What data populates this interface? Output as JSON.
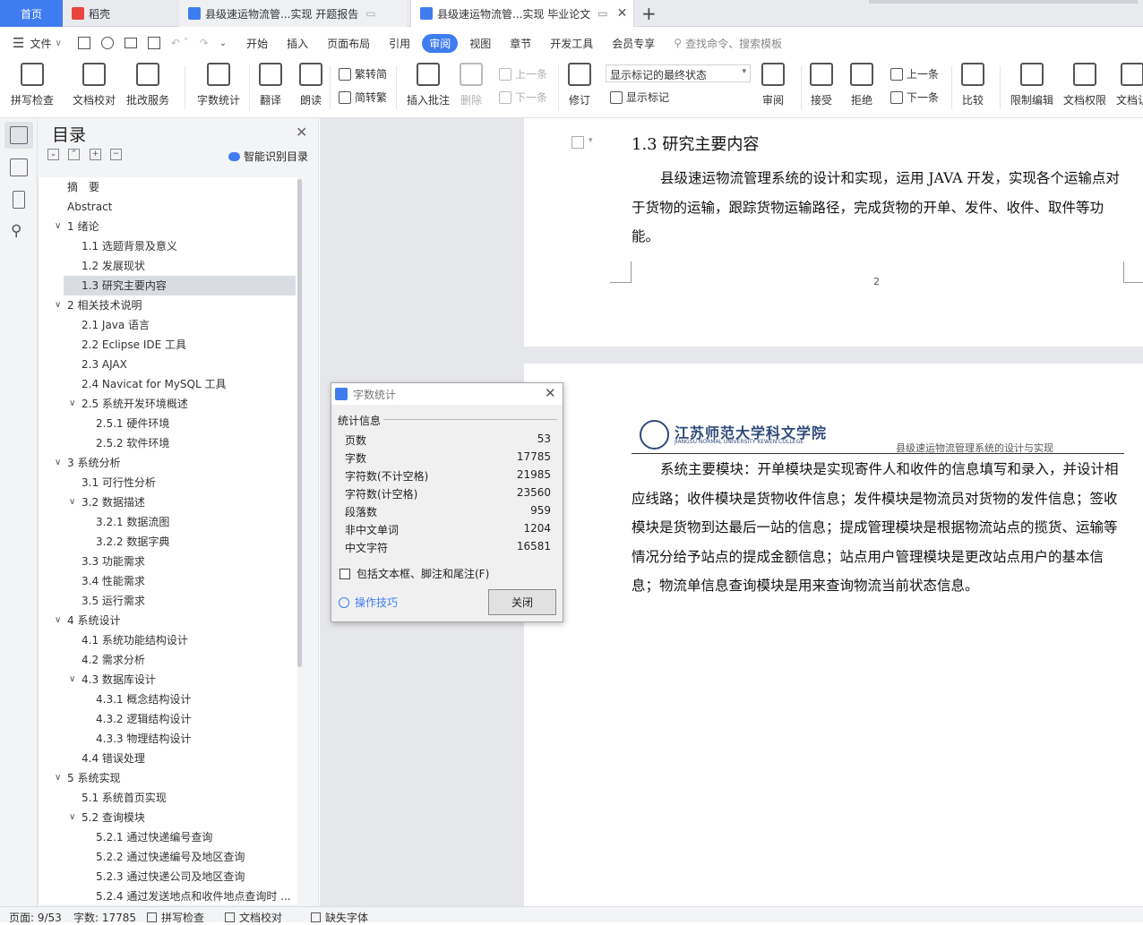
{
  "tabs": [
    {
      "label": "首页"
    },
    {
      "label": "稻壳"
    },
    {
      "label": "县级速运物流管...实现 开题报告"
    },
    {
      "label": "县级速运物流管...实现 毕业论文"
    }
  ],
  "menu": {
    "file": "文件",
    "items": [
      "开始",
      "插入",
      "页面布局",
      "引用",
      "审阅",
      "视图",
      "章节",
      "开发工具",
      "会员专享"
    ],
    "active": "审阅",
    "search_placeholder": "查找命令、搜索模板"
  },
  "ribbon": {
    "spellcheck": "拼写检查",
    "doccheck": "文档校对",
    "correction": "批改服务",
    "wordcount": "字数统计",
    "translate": "翻译",
    "readaloud": "朗读",
    "trad": "繁转简",
    "simp": "简转繁",
    "insert_comment": "插入批注",
    "delete": "删除",
    "prev_comment": "上一条",
    "next_comment": "下一条",
    "revise": "修订",
    "markup_mode": "显示标记的最终状态",
    "show_markup": "显示标记",
    "review": "审阅",
    "accept": "接受",
    "reject": "拒绝",
    "prev": "上一条",
    "next": "下一条",
    "compare": "比较",
    "restrict": "限制编辑",
    "permission": "文档权限",
    "doccheck2": "文档认"
  },
  "toc": {
    "title": "目录",
    "smart_label": "智能识别目录",
    "items": [
      {
        "label": "摘　要",
        "level": 1,
        "toggle": ""
      },
      {
        "label": "Abstract",
        "level": 1,
        "toggle": ""
      },
      {
        "label": "1 绪论",
        "level": 1,
        "toggle": "∨"
      },
      {
        "label": "1.1 选题背景及意义",
        "level": 2,
        "toggle": ""
      },
      {
        "label": "1.2 发展现状",
        "level": 2,
        "toggle": ""
      },
      {
        "label": "1.3 研究主要内容",
        "level": 2,
        "toggle": "",
        "selected": true
      },
      {
        "label": "2 相关技术说明",
        "level": 1,
        "toggle": "∨"
      },
      {
        "label": "2.1 Java 语言",
        "level": 2,
        "toggle": ""
      },
      {
        "label": "2.2 Eclipse IDE 工具",
        "level": 2,
        "toggle": ""
      },
      {
        "label": "2.3 AJAX",
        "level": 2,
        "toggle": ""
      },
      {
        "label": "2.4 Navicat for MySQL 工具",
        "level": 2,
        "toggle": ""
      },
      {
        "label": "2.5 系统开发环境概述",
        "level": 2,
        "toggle": "∨"
      },
      {
        "label": "2.5.1 硬件环境",
        "level": 3,
        "toggle": ""
      },
      {
        "label": "2.5.2 软件环境",
        "level": 3,
        "toggle": ""
      },
      {
        "label": "3 系统分析",
        "level": 1,
        "toggle": "∨"
      },
      {
        "label": "3.1 可行性分析",
        "level": 2,
        "toggle": ""
      },
      {
        "label": "3.2 数据描述",
        "level": 2,
        "toggle": "∨"
      },
      {
        "label": "3.2.1 数据流图",
        "level": 3,
        "toggle": ""
      },
      {
        "label": "3.2.2 数据字典",
        "level": 3,
        "toggle": ""
      },
      {
        "label": "3.3 功能需求",
        "level": 2,
        "toggle": ""
      },
      {
        "label": "3.4 性能需求",
        "level": 2,
        "toggle": ""
      },
      {
        "label": "3.5 运行需求",
        "level": 2,
        "toggle": ""
      },
      {
        "label": "4 系统设计",
        "level": 1,
        "toggle": "∨"
      },
      {
        "label": "4.1 系统功能结构设计",
        "level": 2,
        "toggle": ""
      },
      {
        "label": "4.2 需求分析",
        "level": 2,
        "toggle": ""
      },
      {
        "label": "4.3 数据库设计",
        "level": 2,
        "toggle": "∨"
      },
      {
        "label": "4.3.1 概念结构设计",
        "level": 3,
        "toggle": ""
      },
      {
        "label": "4.3.2 逻辑结构设计",
        "level": 3,
        "toggle": ""
      },
      {
        "label": "4.3.3 物理结构设计",
        "level": 3,
        "toggle": ""
      },
      {
        "label": "4.4 错误处理",
        "level": 2,
        "toggle": ""
      },
      {
        "label": "5 系统实现",
        "level": 1,
        "toggle": "∨"
      },
      {
        "label": "5.1 系统首页实现",
        "level": 2,
        "toggle": ""
      },
      {
        "label": "5.2 查询模块",
        "level": 2,
        "toggle": "∨"
      },
      {
        "label": "5.2.1 通过快递编号查询",
        "level": 3,
        "toggle": ""
      },
      {
        "label": "5.2.2 通过快递编号及地区查询",
        "level": 3,
        "toggle": ""
      },
      {
        "label": "5.2.3 通过快递公司及地区查询",
        "level": 3,
        "toggle": ""
      },
      {
        "label": "5.2.4 通过发送地点和收件地点查询时 ...",
        "level": 3,
        "toggle": ""
      }
    ]
  },
  "document": {
    "heading": "1.3 研究主要内容",
    "para1": "县级速运物流管理系统的设计和实现，运用 JAVA 开发，实现各个运输点对于货物的运输，跟踪货物运输路径，完成货物的开单、发件、收件、取件等功能。",
    "page_number": "2",
    "college_name": "江苏师范大学科文学院",
    "college_en": "JIANGSU NORMAL UNIVERSITY KEWEN COLLEGE",
    "running_header": "县级速运物流管理系统的设计与实现",
    "para2": "系统主要模块：开单模块是实现寄件人和收件的信息填写和录入，并设计相应线路；收件模块是货物收件信息；发件模块是物流员对货物的发件信息；签收模块是货物到达最后一站的信息；提成管理模块是根据物流站点的揽货、运输等情况分给予站点的提成金额信息；站点用户管理模块是更改站点用户的基本信息；物流单信息查询模块是用来查询物流当前状态信息。"
  },
  "dialog": {
    "title": "字数统计",
    "section": "统计信息",
    "stats": [
      {
        "label": "页数",
        "value": "53"
      },
      {
        "label": "字数",
        "value": "17785"
      },
      {
        "label": "字符数(不计空格)",
        "value": "21985"
      },
      {
        "label": "字符数(计空格)",
        "value": "23560"
      },
      {
        "label": "段落数",
        "value": "959"
      },
      {
        "label": "非中文单词",
        "value": "1204"
      },
      {
        "label": "中文字符",
        "value": "16581"
      }
    ],
    "include_label": "包括文本框、脚注和尾注(F)",
    "tips": "操作技巧",
    "close": "关闭"
  },
  "status": {
    "page": "页面: 9/53",
    "words": "字数: 17785",
    "spell": "拼写检查",
    "doccheck": "文档校对",
    "missing_font": "缺失字体"
  },
  "colors": {
    "accent": "#3f7cf0",
    "selected_row": "#d9dde3",
    "canvas": "#e6e7ea"
  }
}
